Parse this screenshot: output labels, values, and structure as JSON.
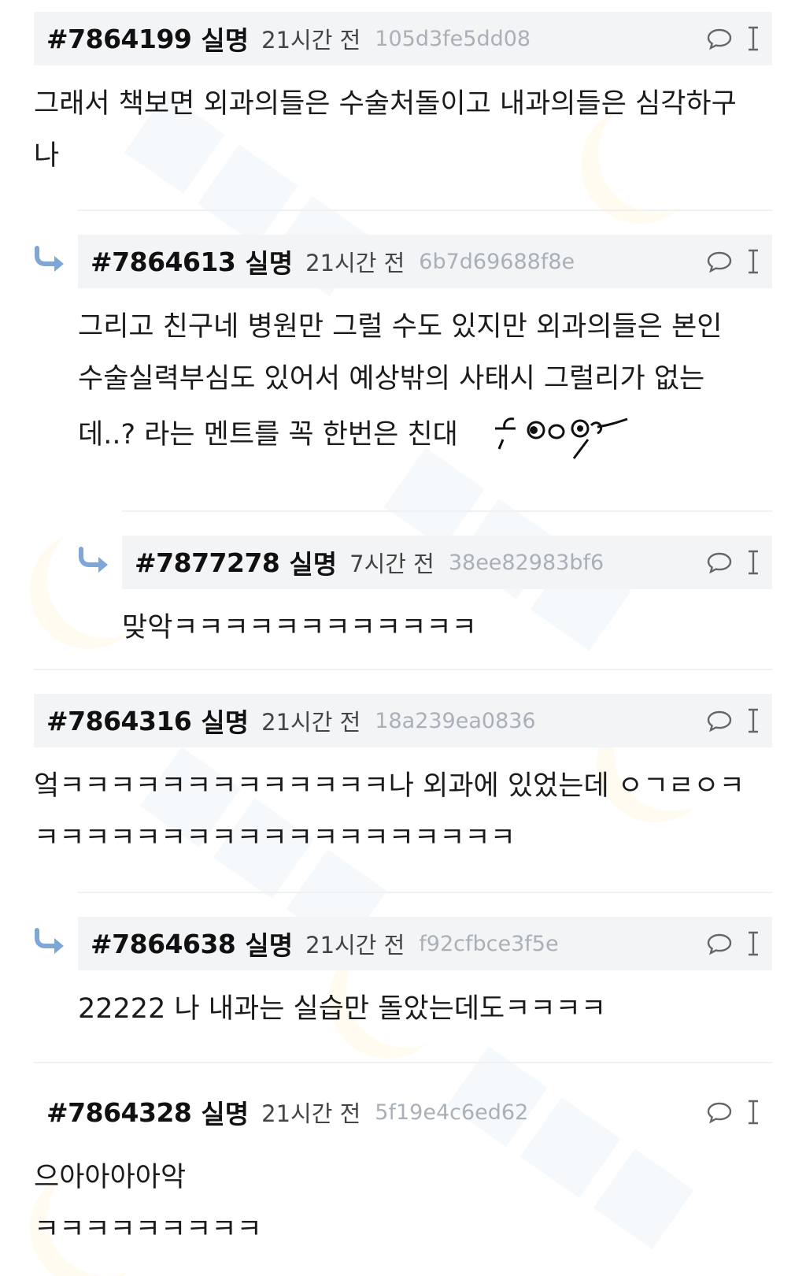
{
  "comments": [
    {
      "id": "#7864199",
      "author": "실명",
      "time": "21시간 전",
      "hash": "105d3fe5dd08",
      "lines": [
        "그래서 책보면 외과의들은 수술처돌이고 내과의들은 심각하구",
        "나"
      ]
    },
    {
      "id": "#7864613",
      "author": "실명",
      "time": "21시간 전",
      "hash": "6b7d69688f8e",
      "lines": [
        "그리고 친구네 병원만 그럴 수도 있지만 외과의들은 본인",
        "수술실력부심도 있어서 예상밖의 사태시 그럴리가 없는",
        "데..? 라는 멘트를 꼭 한번은 친대"
      ]
    },
    {
      "id": "#7877278",
      "author": "실명",
      "time": "7시간 전",
      "hash": "38ee82983bf6",
      "lines": [
        "맞악ㅋㅋㅋㅋㅋㅋㅋㅋㅋㅋㅋㅋ"
      ]
    },
    {
      "id": "#7864316",
      "author": "실명",
      "time": "21시간 전",
      "hash": "18a239ea0836",
      "lines": [
        "엌ㅋㅋㅋㅋㅋㅋㅋㅋㅋㅋㅋㅋㅋ나 외과에 있었는데 ㅇㄱㄹㅇㅋ",
        "ㅋㅋㅋㅋㅋㅋㅋㅋㅋㅋㅋㅋㅋㅋㅋㅋㅋㅋㅋ"
      ]
    },
    {
      "id": "#7864638",
      "author": "실명",
      "time": "21시간 전",
      "hash": "f92cfbce3f5e",
      "lines": [
        "22222 나 내과는 실습만 돌았는데도ㅋㅋㅋㅋ"
      ]
    },
    {
      "id": "#7864328",
      "author": "실명",
      "time": "21시간 전",
      "hash": "5f19e4c6ed62",
      "lines": [
        "으아아아아악",
        "ㅋㅋㅋㅋㅋㅋㅋㅋㅋ"
      ]
    }
  ],
  "icons": {
    "reply": "speech-bubble-icon",
    "more": "text-cursor-icon",
    "nested": "reply-arrow-icon",
    "emoticon": "drawn-face-emoticon"
  },
  "colors": {
    "header_bg": "#f2f4f6",
    "hash": "#a9b0b7",
    "arrow": "#7ea7d8"
  }
}
